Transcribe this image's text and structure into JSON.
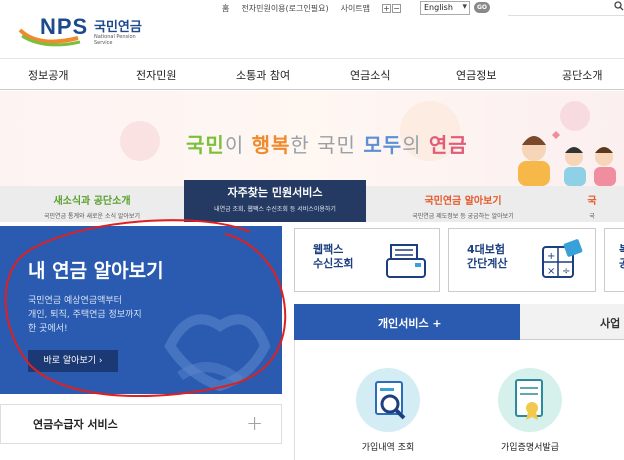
{
  "header": {
    "logo_text": "NPS",
    "logo_korean": "국민연금",
    "logo_english": "National Pension Service",
    "util_links": [
      "홈",
      "전자민원이용(로그인필요)",
      "사이트맵"
    ],
    "zoom_in": "+",
    "zoom_out": "−",
    "language": "English",
    "go_label": "GO",
    "search_icon": "search-icon"
  },
  "nav": {
    "items": [
      "정보공개",
      "전자민원",
      "소통과 참여",
      "연금소식",
      "연금정보",
      "공단소개"
    ]
  },
  "hero": {
    "w1": "국민",
    "w2": "이 ",
    "w3": "행복",
    "w4": "한 국민 ",
    "w5": "모두",
    "w6": "의 ",
    "w7": "연금"
  },
  "tabs": [
    {
      "title": "새소식과 공단소개",
      "sub": "국민연금 통계와 새로운 소식 알아보기"
    },
    {
      "title": "자주찾는 민원서비스",
      "sub": "내연금 조회, 웹팩스 수신조회 등 서비스이용하기"
    },
    {
      "title": "국민연금 알아보기",
      "sub": "국민연금 제도정보 등 궁금하는 알아보기"
    },
    {
      "title": "국",
      "sub": "국"
    }
  ],
  "card": {
    "title": "내 연금 알아보기",
    "desc1": "국민연금 예상연금액부터",
    "desc2": "개인, 퇴직, 주택연금 정보까지",
    "desc3": "한 곳에서!",
    "button": "바로 알아보기 ›"
  },
  "accordion": {
    "title": "연금수급자 서비스",
    "plus": "+"
  },
  "quick": [
    {
      "l1": "웹팩스",
      "l2": "수신조회"
    },
    {
      "l1": "4대보험",
      "l2": "간단계산"
    },
    {
      "l1": "복",
      "l2": "공"
    }
  ],
  "personal": {
    "tab1": "개인서비스 +",
    "tab2": "사업"
  },
  "services": [
    {
      "label": "가입내역 조회"
    },
    {
      "label": "가입증명서발급"
    }
  ]
}
